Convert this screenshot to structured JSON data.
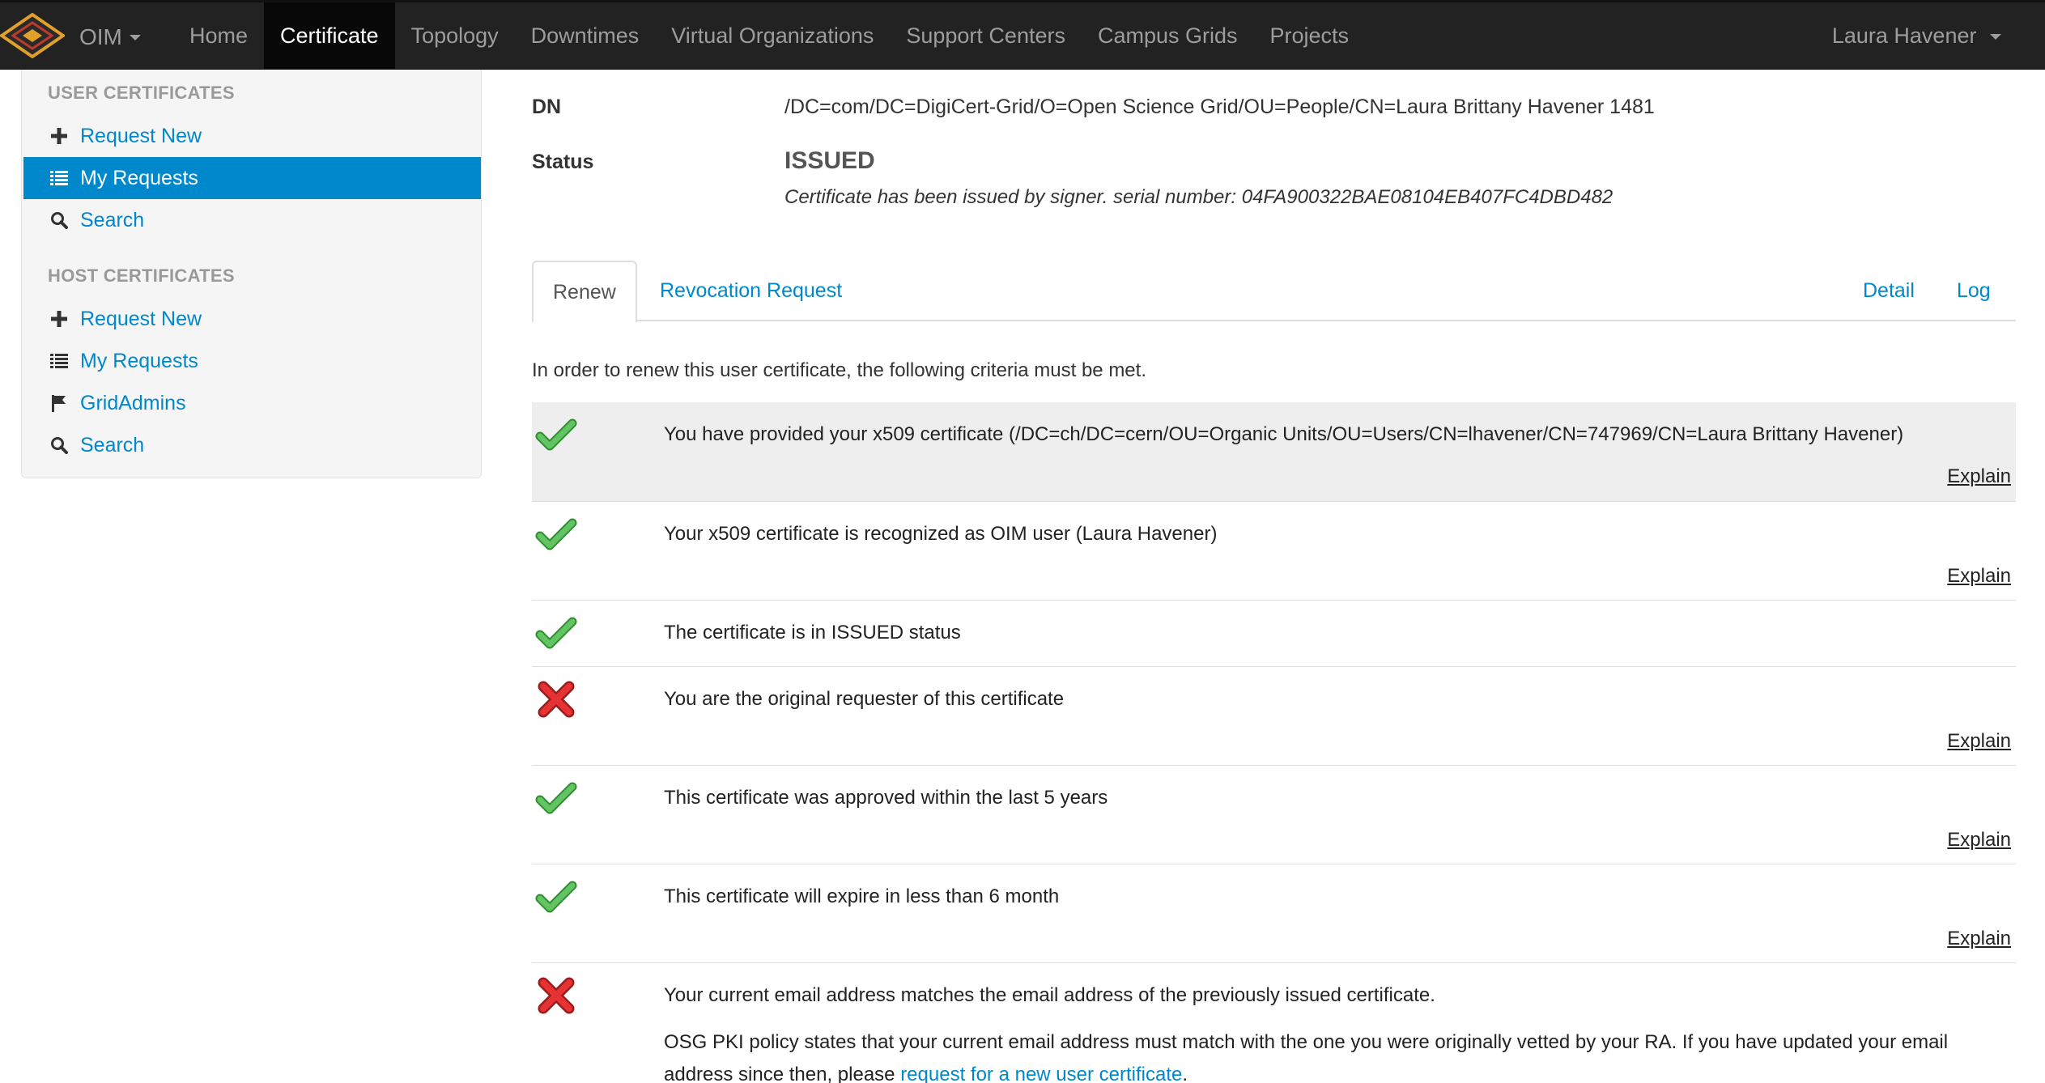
{
  "navbar": {
    "brand": "OIM",
    "items": [
      "Home",
      "Certificate",
      "Topology",
      "Downtimes",
      "Virtual Organizations",
      "Support Centers",
      "Campus Grids",
      "Projects"
    ],
    "user": "Laura Havener"
  },
  "sidebar": {
    "user_header": "USER CERTIFICATES",
    "user_items": [
      "Request New",
      "My Requests",
      "Search"
    ],
    "host_header": "HOST CERTIFICATES",
    "host_items": [
      "Request New",
      "My Requests",
      "GridAdmins",
      "Search"
    ]
  },
  "details": {
    "dn_label": "DN",
    "dn_value": "/DC=com/DC=DigiCert-Grid/O=Open Science Grid/OU=People/CN=Laura Brittany Havener 1481",
    "status_label": "Status",
    "status_value": "ISSUED",
    "status_note": "Certificate has been issued by signer. serial number: 04FA900322BAE08104EB407FC4DBD482"
  },
  "tabs": {
    "renew": "Renew",
    "revocation": "Revocation Request",
    "detail": "Detail",
    "log": "Log"
  },
  "intro": "In order to renew this user certificate, the following criteria must be met.",
  "criteria": [
    {
      "ok": true,
      "text": "You have provided your x509 certificate (/DC=ch/DC=cern/OU=Organic Units/OU=Users/CN=lhavener/CN=747969/CN=Laura Brittany Havener)",
      "explain": "Explain"
    },
    {
      "ok": true,
      "text": "Your x509 certificate is recognized as OIM user (Laura Havener)",
      "explain": "Explain"
    },
    {
      "ok": true,
      "text": "The certificate is in ISSUED status",
      "explain": ""
    },
    {
      "ok": false,
      "text": "You are the original requester of this certificate",
      "explain": "Explain"
    },
    {
      "ok": true,
      "text": "This certificate was approved within the last 5 years",
      "explain": "Explain"
    },
    {
      "ok": true,
      "text": "This certificate will expire in less than 6 month",
      "explain": "Explain"
    },
    {
      "ok": false,
      "text": "Your current email address matches the email address of the previously issued certificate.",
      "explain": ""
    }
  ],
  "email_note": {
    "text": "OSG PKI policy states that your current email address must match with the one you were originally vetted by your RA. If you have updated your email address since then, please",
    "link": "request for a new user certificate",
    "end": "."
  },
  "colors": {
    "navbar": "#222222",
    "link": "#0088cc",
    "active_sidebar": "#0088cc",
    "check": "#4cae4c",
    "cross": "#d9232d"
  }
}
